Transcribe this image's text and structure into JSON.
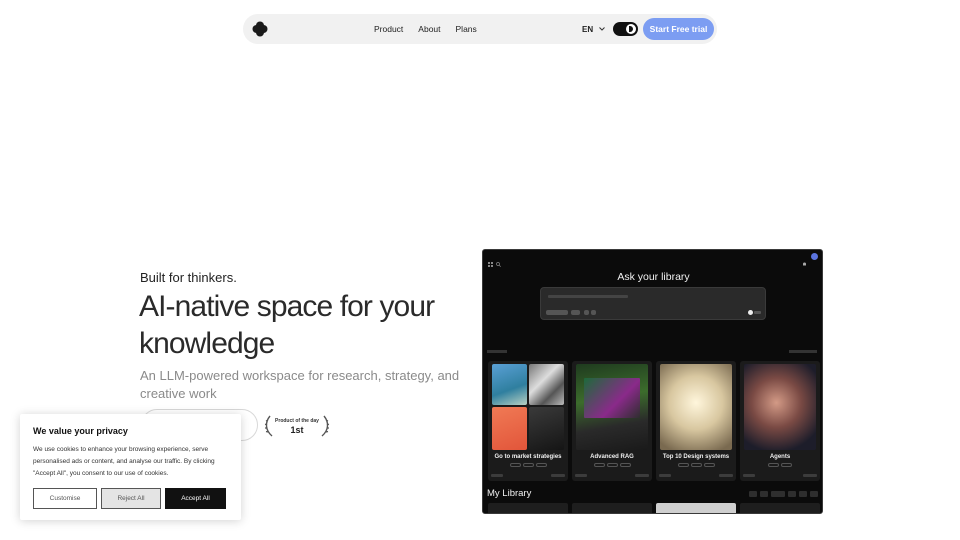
{
  "nav": {
    "links": [
      "Product",
      "About",
      "Plans"
    ],
    "language": "EN",
    "cta_label": "Start Free trial"
  },
  "hero": {
    "kicker": "Built for thinkers.",
    "headline": "AI-native space for your knowledge",
    "subline": "An LLM-powered workspace for research, strategy, and creative work",
    "award_small": "Product of the day",
    "award_big": "1st"
  },
  "app": {
    "ask_title": "Ask your library",
    "cards": [
      {
        "title": "Go to market strategies"
      },
      {
        "title": "Advanced RAG"
      },
      {
        "title": "Top 10 Design systems"
      },
      {
        "title": "Agents"
      }
    ],
    "library_title": "My Library"
  },
  "cookie": {
    "title": "We value your privacy",
    "text": "We use cookies to enhance your browsing experience, serve personalised ads or content, and analyse our traffic. By clicking \"Accept All\", you consent to our use of cookies.",
    "customise_label": "Customise",
    "reject_label": "Reject All",
    "accept_label": "Accept All"
  },
  "colors": {
    "accent": "#7c9df2",
    "app_background": "#0b0b0b"
  }
}
